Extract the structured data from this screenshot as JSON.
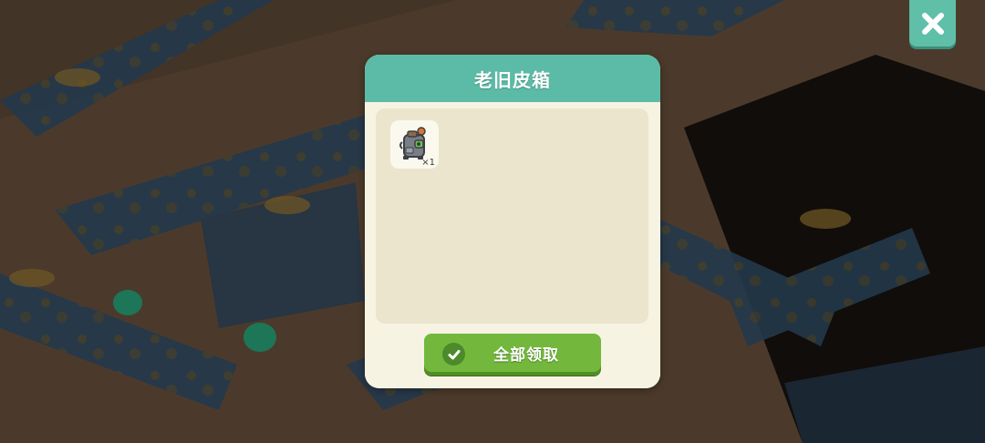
{
  "game": {
    "close_icon": "close-x-icon",
    "accent_color": "#5cbba6"
  },
  "dialog": {
    "title": "老旧皮箱",
    "items": [
      {
        "icon": "old-suitcase-robot-icon",
        "count": "×1"
      }
    ],
    "claim_button": {
      "icon": "checkmark-icon",
      "label": "全部领取",
      "color": "#73b83c"
    }
  }
}
